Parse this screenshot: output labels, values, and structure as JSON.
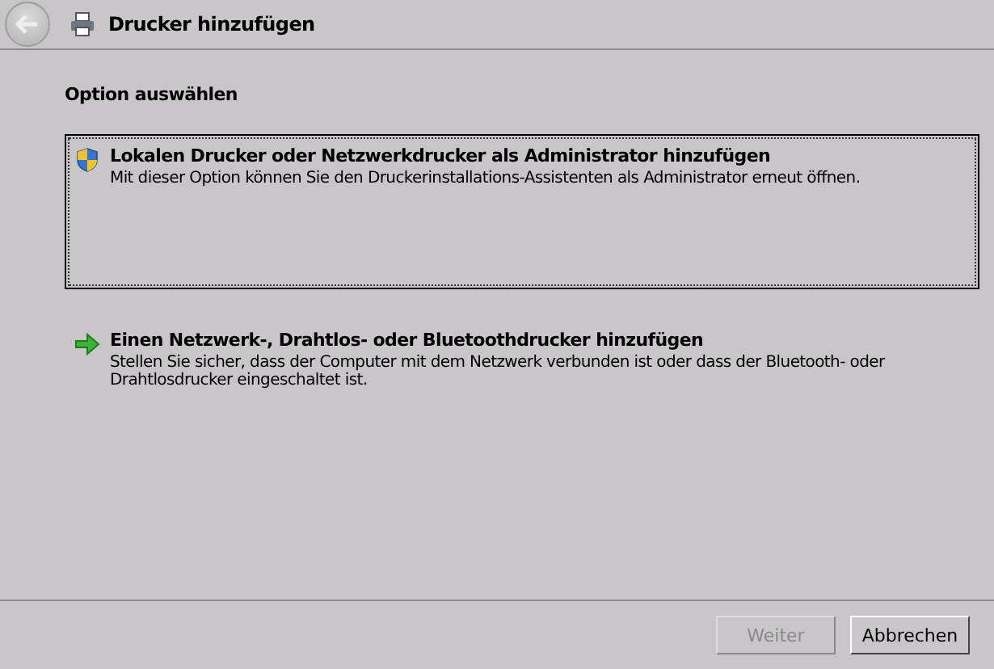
{
  "window": {
    "title": "Drucker hinzufügen",
    "back_disabled": true
  },
  "heading": "Option auswählen",
  "options": [
    {
      "kind": "admin",
      "title": "Lokalen Drucker oder Netzwerkdrucker als Administrator hinzufügen",
      "description": "Mit dieser Option können Sie den Druckerinstallations-Assistenten als Administrator erneut öffnen.",
      "selected": true
    },
    {
      "kind": "arrow",
      "title": "Einen Netzwerk-, Drahtlos- oder Bluetoothdrucker hinzufügen",
      "description": "Stellen Sie sicher, dass der Computer mit dem Netzwerk verbunden ist oder dass der Bluetooth- oder Drahtlosdrucker eingeschaltet ist.",
      "selected": false
    }
  ],
  "buttons": [
    {
      "label": "Weiter",
      "disabled": true
    },
    {
      "label": "Abbrechen",
      "disabled": false
    }
  ]
}
